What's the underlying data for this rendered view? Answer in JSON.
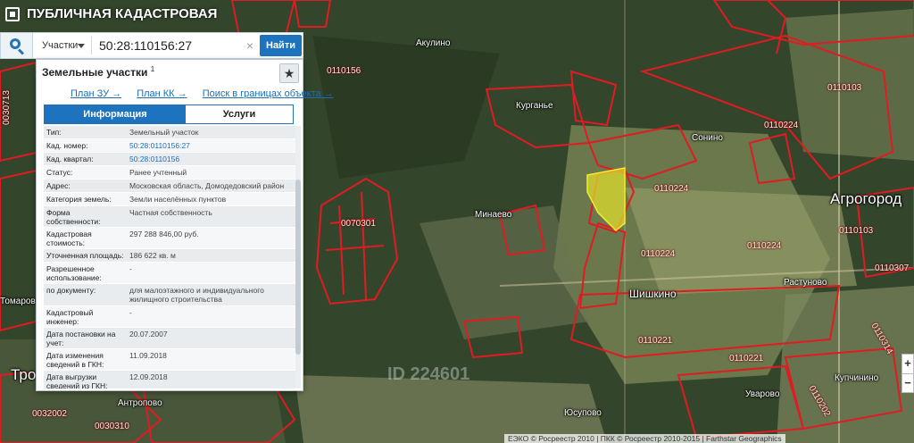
{
  "app": {
    "title": "ПУБЛИЧНАЯ КАДАСТРОВАЯ КАРТА"
  },
  "search": {
    "type_value": "Участки",
    "query": "50:28:110156:27",
    "clear_label": "×",
    "find_label": "Найти"
  },
  "panel": {
    "title": "Земельные участки",
    "title_count": "1",
    "star_label": "★",
    "links": [
      "План ЗУ →",
      "План КК →",
      "Поиск в границах объекта →"
    ],
    "tabs": [
      {
        "label": "Информация",
        "active": true
      },
      {
        "label": "Услуги",
        "active": false
      }
    ],
    "rows": [
      {
        "key": "Тип:",
        "value": "Земельный участок",
        "link": false
      },
      {
        "key": "Кад. номер:",
        "value": "50:28:0110156:27",
        "link": true
      },
      {
        "key": "Кад. квартал:",
        "value": "50:28:0110156",
        "link": true
      },
      {
        "key": "Статус:",
        "value": "Ранее учтенный",
        "link": false
      },
      {
        "key": "Адрес:",
        "value": "Московская область, Домодедовский район",
        "link": false
      },
      {
        "key": "Категория земель:",
        "value": "Земли населённых пунктов",
        "link": false
      },
      {
        "key": "Форма собственности:",
        "value": "Частная собственность",
        "link": false
      },
      {
        "key": "Кадастровая стоимость:",
        "value": "297 288 846,00 руб.",
        "link": false
      },
      {
        "key": "Уточненная площадь:",
        "value": "186 622 кв. м",
        "link": false
      },
      {
        "key": "Разрешенное использование:",
        "value": "-",
        "link": false
      },
      {
        "key": "по документу:",
        "value": "для малоэтажного и индивидуального жилищного строительства",
        "link": false
      },
      {
        "key": "Кадастровый инженер:",
        "value": "-",
        "link": false
      },
      {
        "key": "Дата постановки на учет:",
        "value": "20.07.2007",
        "link": false
      },
      {
        "key": "Дата изменения сведений в ГКН:",
        "value": "11.09.2018",
        "link": false
      },
      {
        "key": "Дата выгрузки сведений из ГКН:",
        "value": "12.09.2018",
        "link": false
      }
    ]
  },
  "map": {
    "places": [
      {
        "text": "Акулино",
        "cls": "place"
      },
      {
        "text": "Курганье",
        "cls": "place"
      },
      {
        "text": "Сонино",
        "cls": "place"
      },
      {
        "text": "Минаево",
        "cls": "place"
      },
      {
        "text": "Агрогород",
        "cls": "big"
      },
      {
        "text": "Шишкино",
        "cls": "place"
      },
      {
        "text": "Растуново",
        "cls": "place"
      },
      {
        "text": "Томарово",
        "cls": "place"
      },
      {
        "text": "Антропово",
        "cls": "place"
      },
      {
        "text": "Юсупово",
        "cls": "place"
      },
      {
        "text": "Уварово",
        "cls": "place"
      },
      {
        "text": "Купчинино",
        "cls": "place"
      },
      {
        "text": "Тро",
        "cls": "big"
      }
    ],
    "cadastral": [
      "0110156",
      "0110103",
      "0110224",
      "0110224",
      "0070301",
      "0110224",
      "0110224",
      "0110103",
      "0110307",
      "0110221",
      "0110221",
      "0110202",
      "0032002",
      "0030310",
      "0030713",
      "0110314"
    ],
    "watermark": "ID 224601",
    "zoom_in": "+",
    "zoom_out": "−",
    "attribution": "ЕЭКО © Росреестр 2010 | ПКК © Росреестр 2010-2015 | Farthstar Geographics"
  }
}
